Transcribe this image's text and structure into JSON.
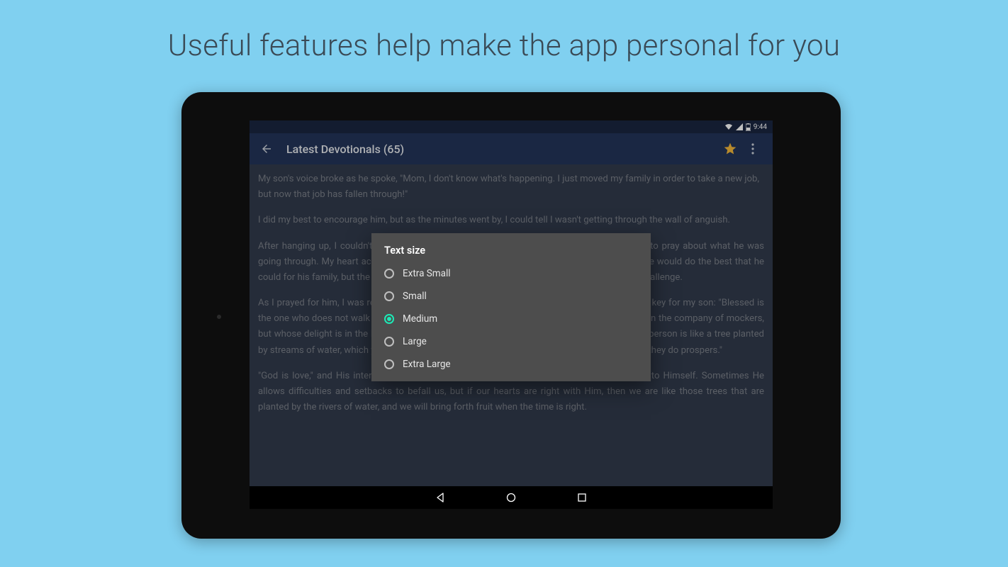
{
  "headline": "Useful features help make the app personal for you",
  "status": {
    "time": "9:44"
  },
  "appbar": {
    "title": "Latest Devotionals (65)"
  },
  "content": {
    "p1": "My son's voice broke as he spoke, \"Mom, I don't know what's happening. I just moved my family in order to take a new job, but now that job has fallen through!\"",
    "p2": "I did my best to encourage him, but as the minutes went by, I could tell I wasn't getting through the wall of anguish.",
    "p3": "After hanging up, I couldn't go to sleep, so I opened my Bible and set aside everything else to pray about what he was going through. My heart ached for him and for his wife—capable young parents. I knew that he would do the best that he could for his family, but the current worldwide economic slump meant it was even more of a challenge.",
    "p4": "As I prayed for him, I was reminded of Psalm 1. I knew in my heart that these verses were the key for my son: \"Blessed is the one who does not walk in step with the wicked or stand in the way that sinners take or sit in the company of mockers, but whose delight is in the law of the Lord, and who meditates on his law day and night. That person is like a tree planted by streams of water, which yields its fruit in season and whose leaf does not wither—whatever they do prospers.\"",
    "p5": "\"God is love,\" and His interactions with us are loving. He is always trying to draw us closer to Himself. Sometimes He allows difficulties and setbacks to befall us, but if our hearts are right with Him, then we are like those trees that are planted by the rivers of water, and we will bring forth fruit when the time is right."
  },
  "dialog": {
    "title": "Text size",
    "options": [
      {
        "label": "Extra Small",
        "selected": false
      },
      {
        "label": "Small",
        "selected": false
      },
      {
        "label": "Medium",
        "selected": true
      },
      {
        "label": "Large",
        "selected": false
      },
      {
        "label": "Extra Large",
        "selected": false
      }
    ]
  }
}
